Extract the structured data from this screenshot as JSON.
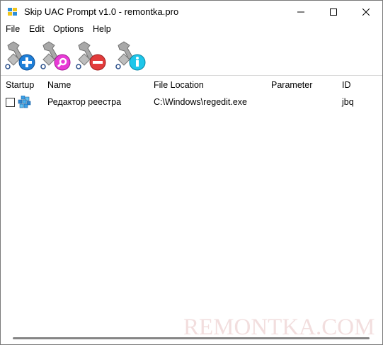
{
  "window": {
    "title": "Skip UAC Prompt v1.0 - remontka.pro"
  },
  "menu": {
    "items": [
      "File",
      "Edit",
      "Options",
      "Help"
    ]
  },
  "toolbar": {
    "buttons": [
      {
        "icon": "wrench-add-icon",
        "badge_color": "#1e7fd8"
      },
      {
        "icon": "wrench-edit-icon",
        "badge_color": "#e83ad6"
      },
      {
        "icon": "wrench-remove-icon",
        "badge_color": "#e23b3b"
      },
      {
        "icon": "wrench-info-icon",
        "badge_color": "#1ec6ea"
      }
    ]
  },
  "list": {
    "columns": [
      "Startup",
      "Name",
      "File Location",
      "Parameter",
      "ID"
    ],
    "rows": [
      {
        "startup": false,
        "name": "Редактор реестра",
        "location": "C:\\Windows\\regedit.exe",
        "parameter": "",
        "id": "jbq"
      }
    ]
  },
  "watermark": "REMONTKA.COM"
}
